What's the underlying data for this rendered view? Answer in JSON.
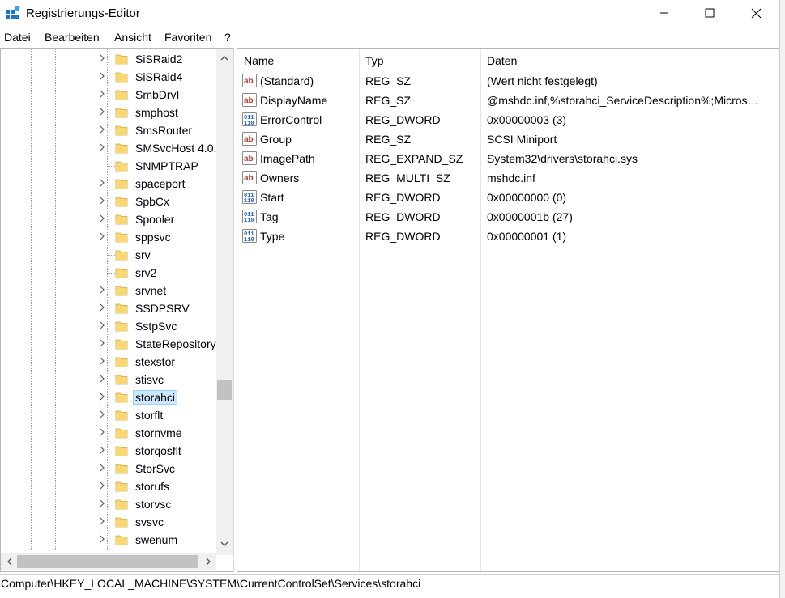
{
  "window": {
    "title": "Registrierungs-Editor"
  },
  "menu": [
    "Datei",
    "Bearbeiten",
    "Ansicht",
    "Favoriten",
    "?"
  ],
  "tree": {
    "items": [
      {
        "label": "SiSRaid2",
        "expandable": true,
        "selected": false
      },
      {
        "label": "SiSRaid4",
        "expandable": true,
        "selected": false
      },
      {
        "label": "SmbDrvI",
        "expandable": true,
        "selected": false
      },
      {
        "label": "smphost",
        "expandable": true,
        "selected": false
      },
      {
        "label": "SmsRouter",
        "expandable": true,
        "selected": false
      },
      {
        "label": "SMSvcHost 4.0.",
        "expandable": true,
        "selected": false
      },
      {
        "label": "SNMPTRAP",
        "expandable": false,
        "selected": false
      },
      {
        "label": "spaceport",
        "expandable": true,
        "selected": false
      },
      {
        "label": "SpbCx",
        "expandable": true,
        "selected": false
      },
      {
        "label": "Spooler",
        "expandable": true,
        "selected": false
      },
      {
        "label": "sppsvc",
        "expandable": true,
        "selected": false
      },
      {
        "label": "srv",
        "expandable": false,
        "selected": false
      },
      {
        "label": "srv2",
        "expandable": false,
        "selected": false
      },
      {
        "label": "srvnet",
        "expandable": true,
        "selected": false
      },
      {
        "label": "SSDPSRV",
        "expandable": true,
        "selected": false
      },
      {
        "label": "SstpSvc",
        "expandable": true,
        "selected": false
      },
      {
        "label": "StateRepository",
        "expandable": true,
        "selected": false
      },
      {
        "label": "stexstor",
        "expandable": true,
        "selected": false
      },
      {
        "label": "stisvc",
        "expandable": true,
        "selected": false
      },
      {
        "label": "storahci",
        "expandable": true,
        "selected": true
      },
      {
        "label": "storflt",
        "expandable": true,
        "selected": false
      },
      {
        "label": "stornvme",
        "expandable": true,
        "selected": false
      },
      {
        "label": "storqosflt",
        "expandable": true,
        "selected": false
      },
      {
        "label": "StorSvc",
        "expandable": true,
        "selected": false
      },
      {
        "label": "storufs",
        "expandable": true,
        "selected": false
      },
      {
        "label": "storvsc",
        "expandable": true,
        "selected": false
      },
      {
        "label": "svsvc",
        "expandable": true,
        "selected": false
      },
      {
        "label": "swenum",
        "expandable": true,
        "selected": false
      }
    ]
  },
  "values": {
    "columns": [
      "Name",
      "Typ",
      "Daten"
    ],
    "rows": [
      {
        "icon": "string-value-icon",
        "name": "(Standard)",
        "type": "REG_SZ",
        "data": "(Wert nicht festgelegt)"
      },
      {
        "icon": "string-value-icon",
        "name": "DisplayName",
        "type": "REG_SZ",
        "data": "@mshdc.inf,%storahci_ServiceDescription%;Micros…"
      },
      {
        "icon": "binary-value-icon",
        "name": "ErrorControl",
        "type": "REG_DWORD",
        "data": "0x00000003 (3)"
      },
      {
        "icon": "string-value-icon",
        "name": "Group",
        "type": "REG_SZ",
        "data": "SCSI Miniport"
      },
      {
        "icon": "string-value-icon",
        "name": "ImagePath",
        "type": "REG_EXPAND_SZ",
        "data": "System32\\drivers\\storahci.sys"
      },
      {
        "icon": "string-value-icon",
        "name": "Owners",
        "type": "REG_MULTI_SZ",
        "data": "mshdc.inf"
      },
      {
        "icon": "binary-value-icon",
        "name": "Start",
        "type": "REG_DWORD",
        "data": "0x00000000 (0)"
      },
      {
        "icon": "binary-value-icon",
        "name": "Tag",
        "type": "REG_DWORD",
        "data": "0x0000001b (27)"
      },
      {
        "icon": "binary-value-icon",
        "name": "Type",
        "type": "REG_DWORD",
        "data": "0x00000001 (1)"
      }
    ]
  },
  "status": {
    "path": "Computer\\HKEY_LOCAL_MACHINE\\SYSTEM\\CurrentControlSet\\Services\\storahci"
  },
  "colors": {
    "selection_bg": "#cce8ff",
    "selection_border": "#99d1ff",
    "folder": "#f8d775"
  }
}
